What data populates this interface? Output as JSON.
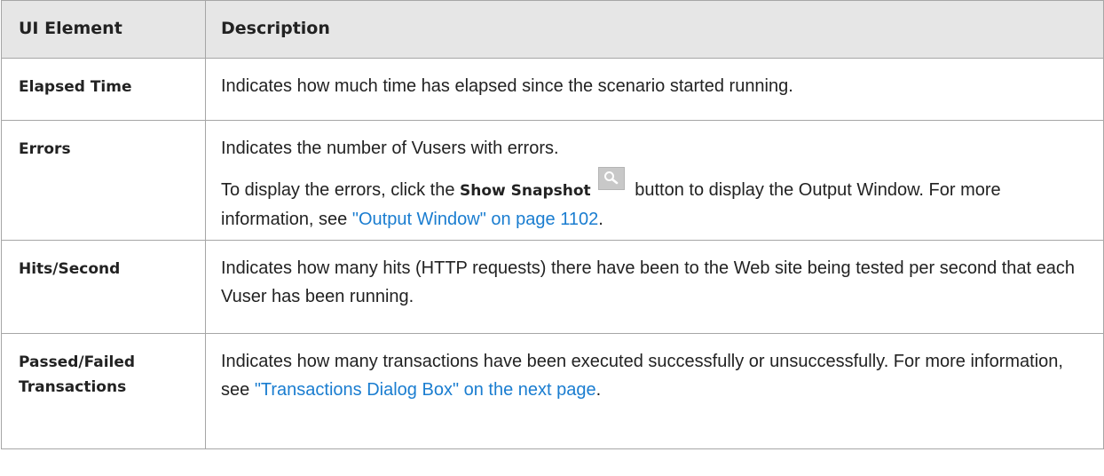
{
  "header": {
    "col1": "UI Element",
    "col2": "Description"
  },
  "rows": [
    {
      "name": "Elapsed Time",
      "desc": "Indicates how much time has elapsed since the scenario started running."
    },
    {
      "name": "Errors",
      "desc1": "Indicates the number of Vusers with errors.",
      "desc2_pre": "To display the errors, click the ",
      "desc2_bold": "Show Snapshot",
      "desc2_mid": " button to display the Output Window. For more information, see ",
      "desc2_link": "\"Output Window\" on page 1102",
      "desc2_post": ".",
      "icon": "magnifier-icon"
    },
    {
      "name": "Hits/Second",
      "desc": "Indicates how many hits (HTTP requests) there have been to the Web site being tested per second that each Vuser has been running."
    },
    {
      "name_line1": "Passed/Failed",
      "name_line2": "Transactions",
      "desc_pre": "Indicates how many transactions have been executed successfully or unsuccessfully. For more information, see ",
      "desc_link": "\"Transactions Dialog Box\" on the next page",
      "desc_post": "."
    }
  ],
  "colors": {
    "header_bg": "#e6e6e6",
    "border": "#a6a6a6",
    "link": "#1a7dd0",
    "text": "#222222"
  }
}
